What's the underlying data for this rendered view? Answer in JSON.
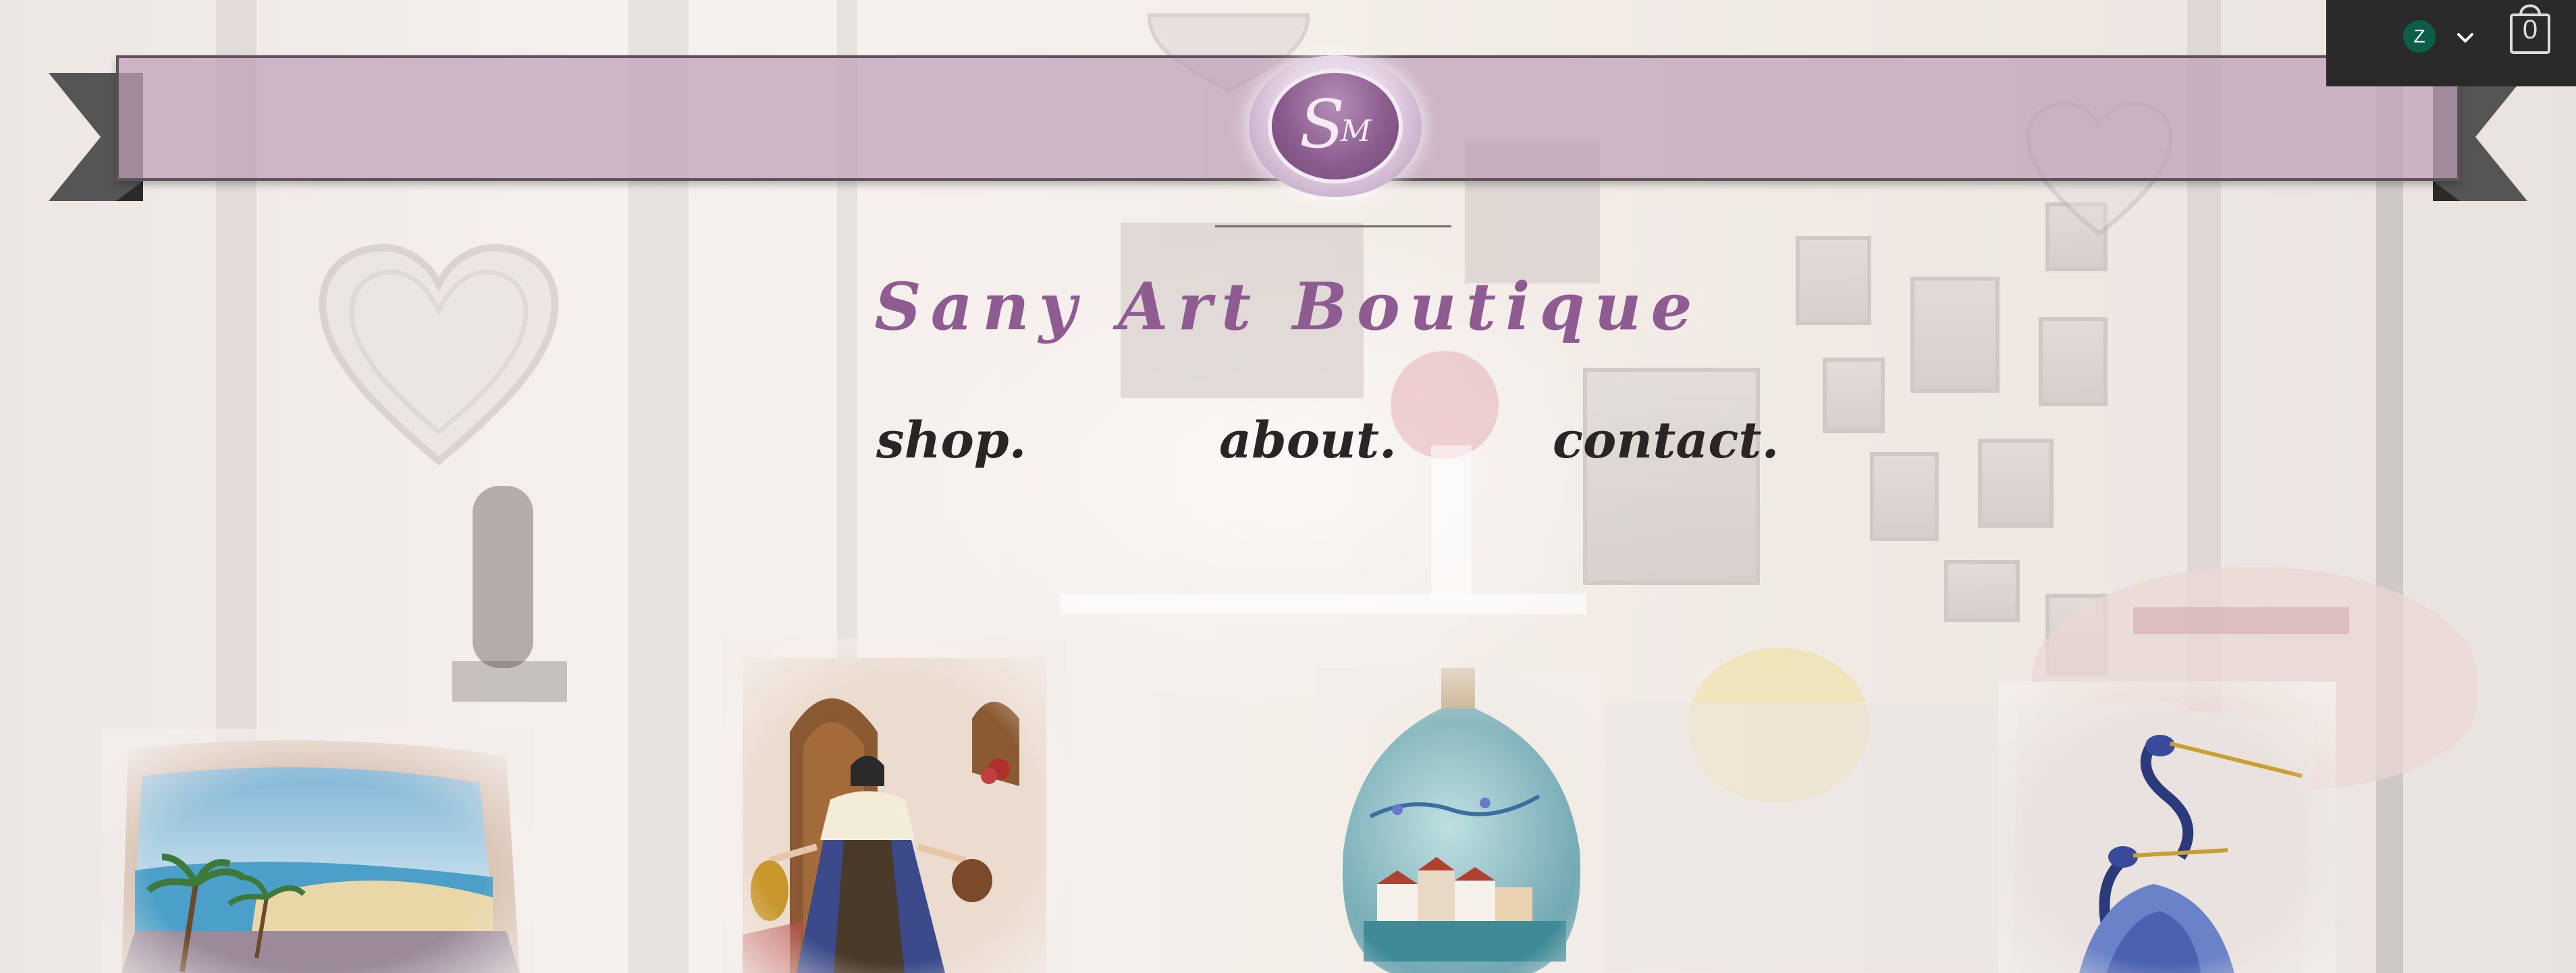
{
  "brand": {
    "logo_initial_s": "S",
    "logo_initial_m": "M",
    "title": "Sany Art Boutique",
    "accent_color": "#8e5c91"
  },
  "nav": {
    "items": [
      {
        "label": "shop."
      },
      {
        "label": "about."
      },
      {
        "label": "contact."
      }
    ]
  },
  "account": {
    "avatar_letter": "Z",
    "cart_count": "0",
    "icons": [
      "chevron-down-icon",
      "shopping-bag-icon"
    ]
  },
  "gallery": {
    "items": [
      {
        "name": "painted-seascape-pillow"
      },
      {
        "name": "painted-water-carrier-woman"
      },
      {
        "name": "painted-village-bottle"
      },
      {
        "name": "painted-herons-canvas"
      }
    ]
  }
}
